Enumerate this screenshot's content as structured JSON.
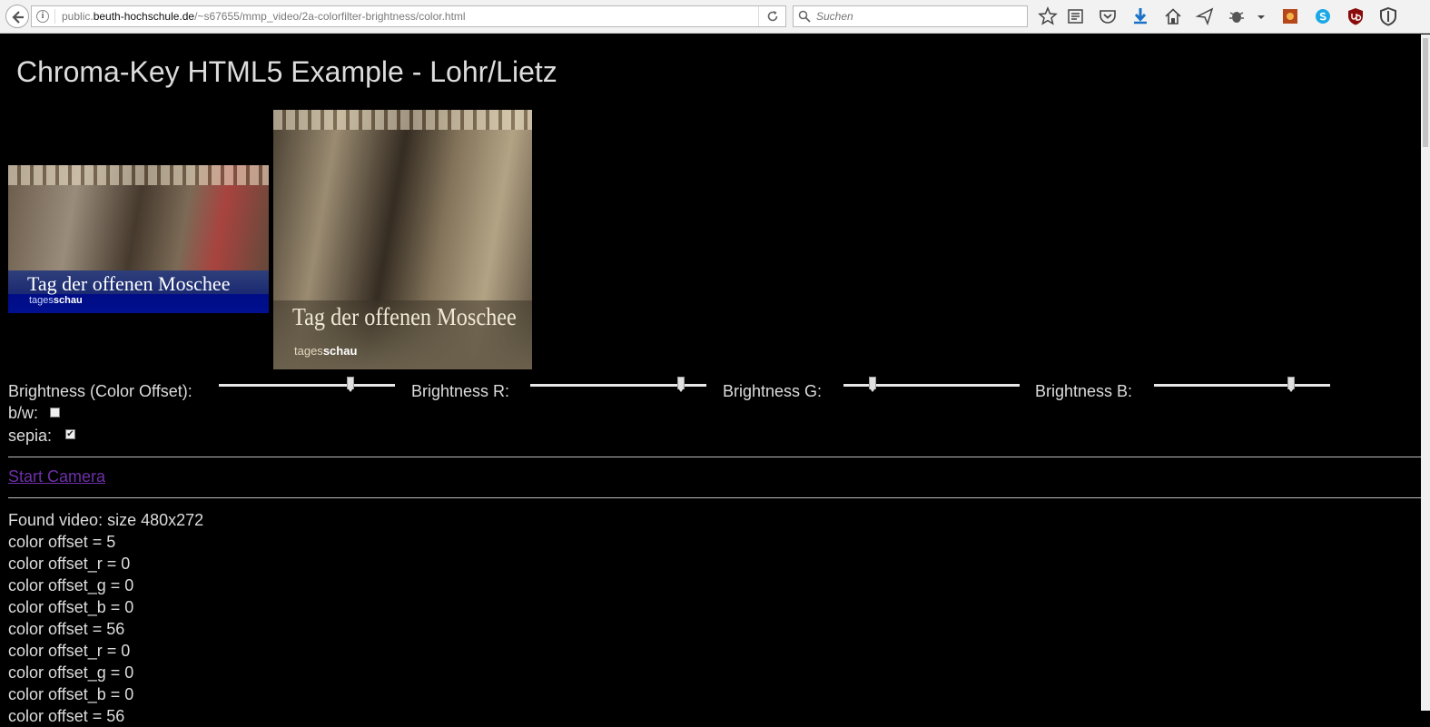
{
  "browser": {
    "url_prefix": "public.",
    "url_domain": "beuth-hochschule.de",
    "url_path": "/~s67655/mmp_video/2a-colorfilter-brightness/color.html",
    "search_placeholder": "Suchen"
  },
  "page": {
    "title": "Chroma-Key HTML5 Example - Lohr/Lietz",
    "video_caption": "Tag der offenen Moschee",
    "video_brand_a": "tages",
    "video_brand_b": "schau"
  },
  "controls": {
    "brightness_label": "Brightness (Color Offset):",
    "brightness_r_label": "Brightness R:",
    "brightness_g_label": "Brightness G:",
    "brightness_b_label": "Brightness B:",
    "brightness_value": 0.76,
    "brightness_r_value": 0.87,
    "brightness_g_value": 0.15,
    "brightness_b_value": 0.79,
    "bw_label": "b/w:",
    "bw_checked": false,
    "sepia_label": "sepia:",
    "sepia_checked": true
  },
  "camera": {
    "start_label": "Start Camera"
  },
  "log": [
    "Found video: size 480x272",
    "color offset = 5",
    "color offset_r = 0",
    "color offset_g = 0",
    "color offset_b = 0",
    "color offset = 56",
    "color offset_r = 0",
    "color offset_g = 0",
    "color offset_b = 0"
  ],
  "log_partial": "color offset = 56"
}
